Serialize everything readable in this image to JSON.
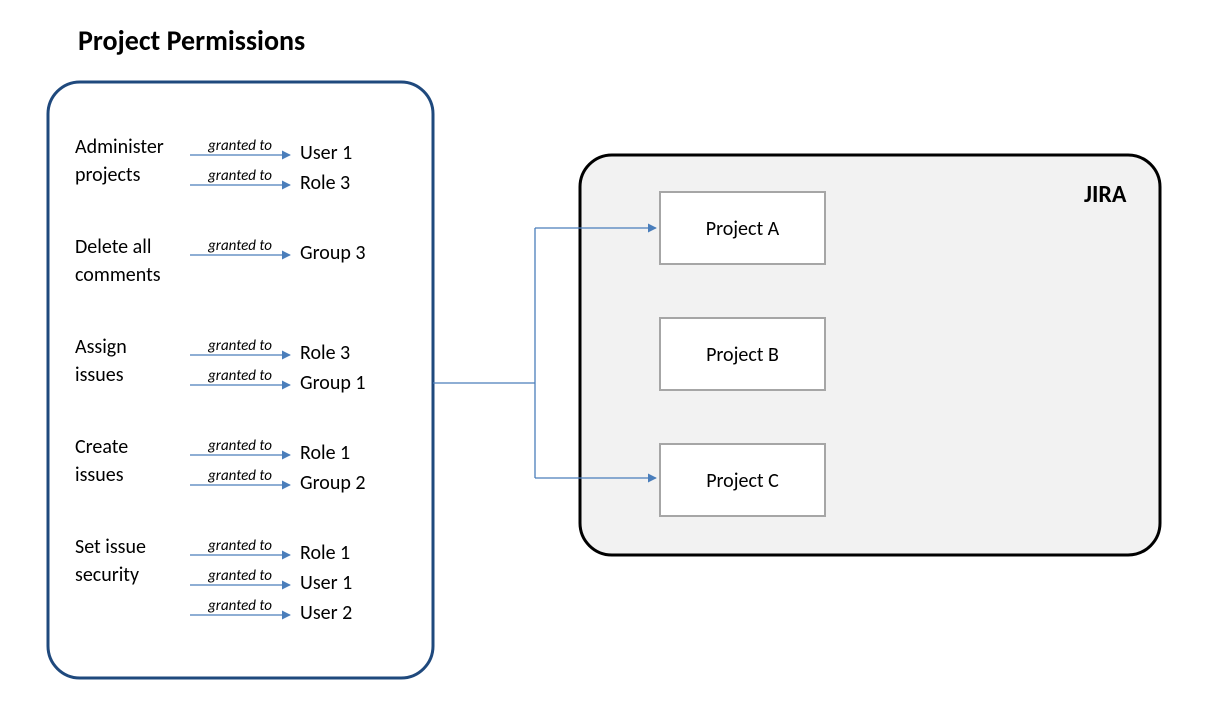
{
  "title": "Project Permissions",
  "grant_label": "granted to",
  "permissions": [
    {
      "name_line1": "Administer",
      "name_line2": "projects",
      "grantees": [
        "User 1",
        "Role 3"
      ]
    },
    {
      "name_line1": "Delete all",
      "name_line2": "comments",
      "grantees": [
        "Group 3"
      ]
    },
    {
      "name_line1": "Assign",
      "name_line2": "issues",
      "grantees": [
        "Role 3",
        "Group 1"
      ]
    },
    {
      "name_line1": "Create",
      "name_line2": "issues",
      "grantees": [
        "Role 1",
        "Group 2"
      ]
    },
    {
      "name_line1": "Set issue",
      "name_line2": "security",
      "grantees": [
        "Role 1",
        "User 1",
        "User 2"
      ]
    }
  ],
  "jira": {
    "label": "JIRA",
    "projects": [
      "Project A",
      "Project B",
      "Project C"
    ]
  }
}
